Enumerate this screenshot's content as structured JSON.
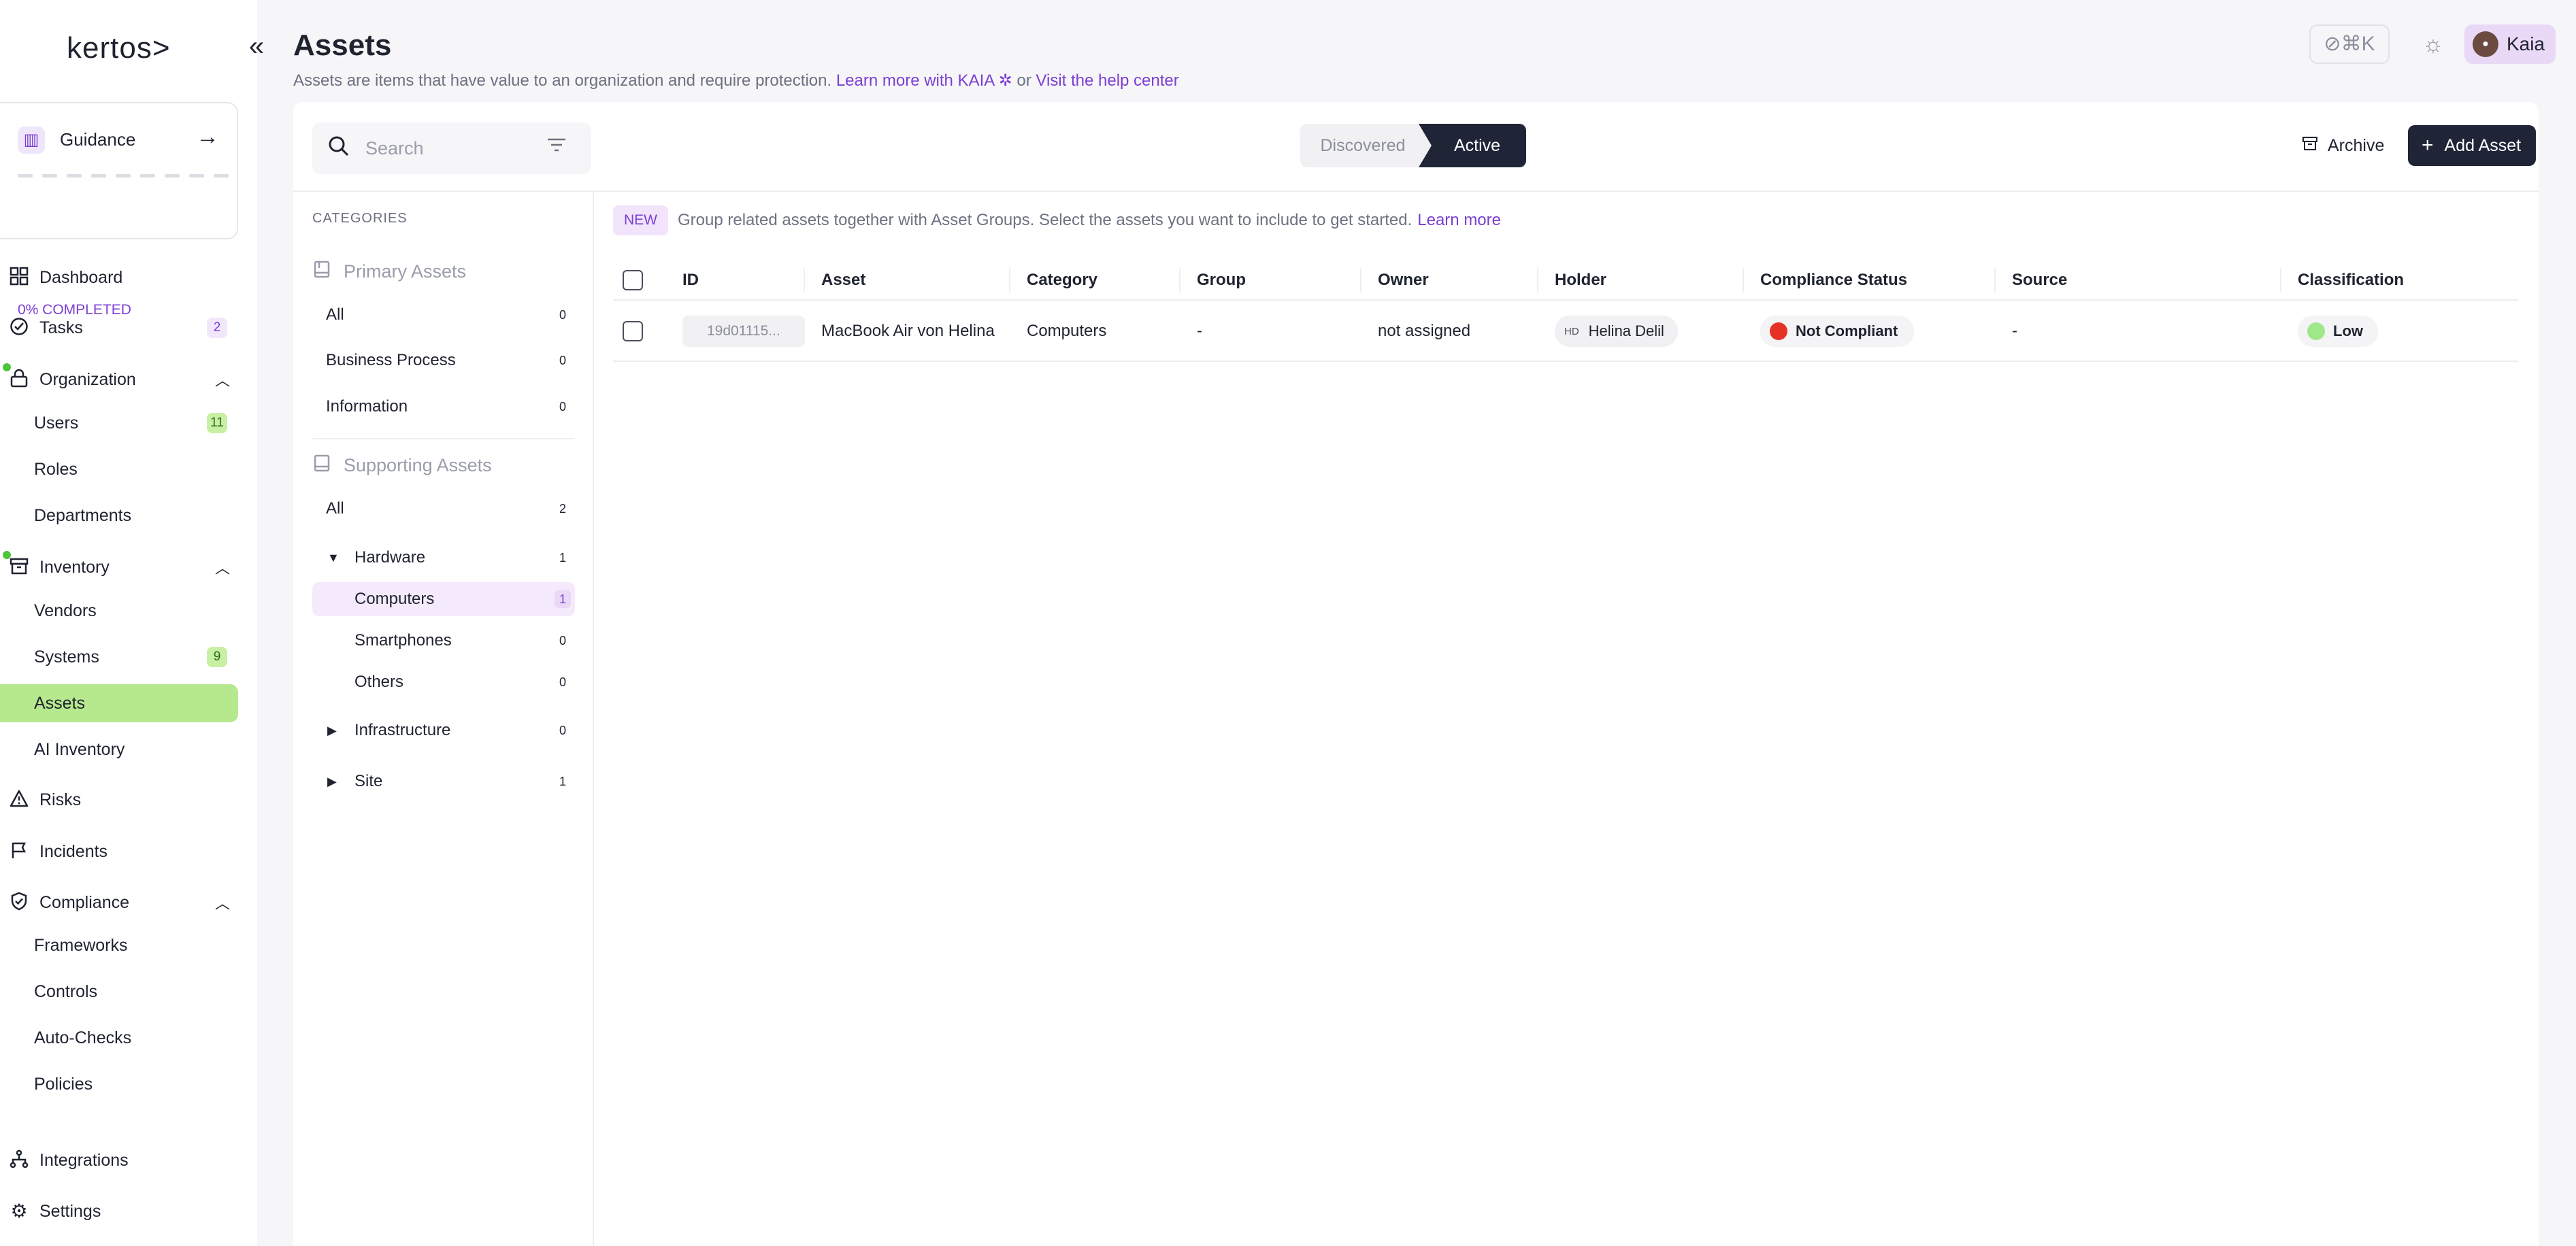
{
  "colors": {
    "accent": "#7b3fd4",
    "active_nav": "#b6e98d",
    "primary_button": "#1f2537",
    "status_not_compliant": "#e53224",
    "classification_low": "#9ee88a"
  },
  "sidebar": {
    "logo": "kertos>",
    "collapse_icon": "chevrons-left-icon",
    "guidance": {
      "label": "Guidance",
      "progress_text": "0% COMPLETED",
      "icon": "map-icon"
    },
    "items": [
      {
        "label": "Dashboard",
        "icon": "grid-icon"
      },
      {
        "label": "Tasks",
        "icon": "check-circle-icon",
        "count": "2"
      },
      {
        "label": "Organization",
        "icon": "lock-icon"
      },
      {
        "label": "Users",
        "count": "11"
      },
      {
        "label": "Roles"
      },
      {
        "label": "Departments"
      },
      {
        "label": "Inventory",
        "icon": "archive-icon"
      },
      {
        "label": "Vendors"
      },
      {
        "label": "Systems",
        "count": "9"
      },
      {
        "label": "Assets",
        "active": true
      },
      {
        "label": "AI Inventory"
      },
      {
        "label": "Risks",
        "icon": "warning-icon"
      },
      {
        "label": "Incidents",
        "icon": "flag-icon"
      },
      {
        "label": "Compliance",
        "icon": "shield-check-icon"
      },
      {
        "label": "Frameworks"
      },
      {
        "label": "Controls"
      },
      {
        "label": "Auto-Checks"
      },
      {
        "label": "Policies"
      },
      {
        "label": "Integrations",
        "icon": "network-icon"
      },
      {
        "label": "Settings",
        "icon": "gear-icon"
      }
    ]
  },
  "header": {
    "title": "Assets",
    "subtitle_text": "Assets are items that have value to an organization and require protection.",
    "subtitle_link1": "Learn more with KAIA",
    "subtitle_or": "or",
    "subtitle_link2": "Visit the help center",
    "shortcut": "⌘K",
    "user_name": "Kaia"
  },
  "toolbar": {
    "search_placeholder": "Search",
    "tab_discovered": "Discovered",
    "tab_active": "Active",
    "archive_label": "Archive",
    "add_label": "Add Asset"
  },
  "categories": {
    "heading": "CATEGORIES",
    "primary": {
      "title": "Primary Assets",
      "rows": [
        {
          "label": "All",
          "count": "0"
        },
        {
          "label": "Business Process",
          "count": "0"
        },
        {
          "label": "Information",
          "count": "0"
        }
      ]
    },
    "supporting": {
      "title": "Supporting Assets",
      "rows": [
        {
          "label": "All",
          "count": "2"
        },
        {
          "label": "Hardware",
          "count": "1"
        },
        {
          "label": "Computers",
          "count": "1"
        },
        {
          "label": "Smartphones",
          "count": "0"
        },
        {
          "label": "Others",
          "count": "0"
        },
        {
          "label": "Infrastructure",
          "count": "0"
        },
        {
          "label": "Site",
          "count": "1"
        }
      ]
    }
  },
  "banner": {
    "badge": "NEW",
    "text": "Group related assets together with Asset Groups. Select the assets you want to include to get started.",
    "link": "Learn more"
  },
  "table": {
    "columns": [
      "ID",
      "Asset",
      "Category",
      "Group",
      "Owner",
      "Holder",
      "Compliance Status",
      "Source",
      "Classification"
    ],
    "rows": [
      {
        "id": "19d01115...",
        "asset": "MacBook Air von Helina",
        "category": "Computers",
        "group": "-",
        "owner": "not assigned",
        "holder_initials": "HD",
        "holder": "Helina Delil",
        "compliance_status": "Not Compliant",
        "source": "-",
        "classification": "Low"
      }
    ]
  }
}
